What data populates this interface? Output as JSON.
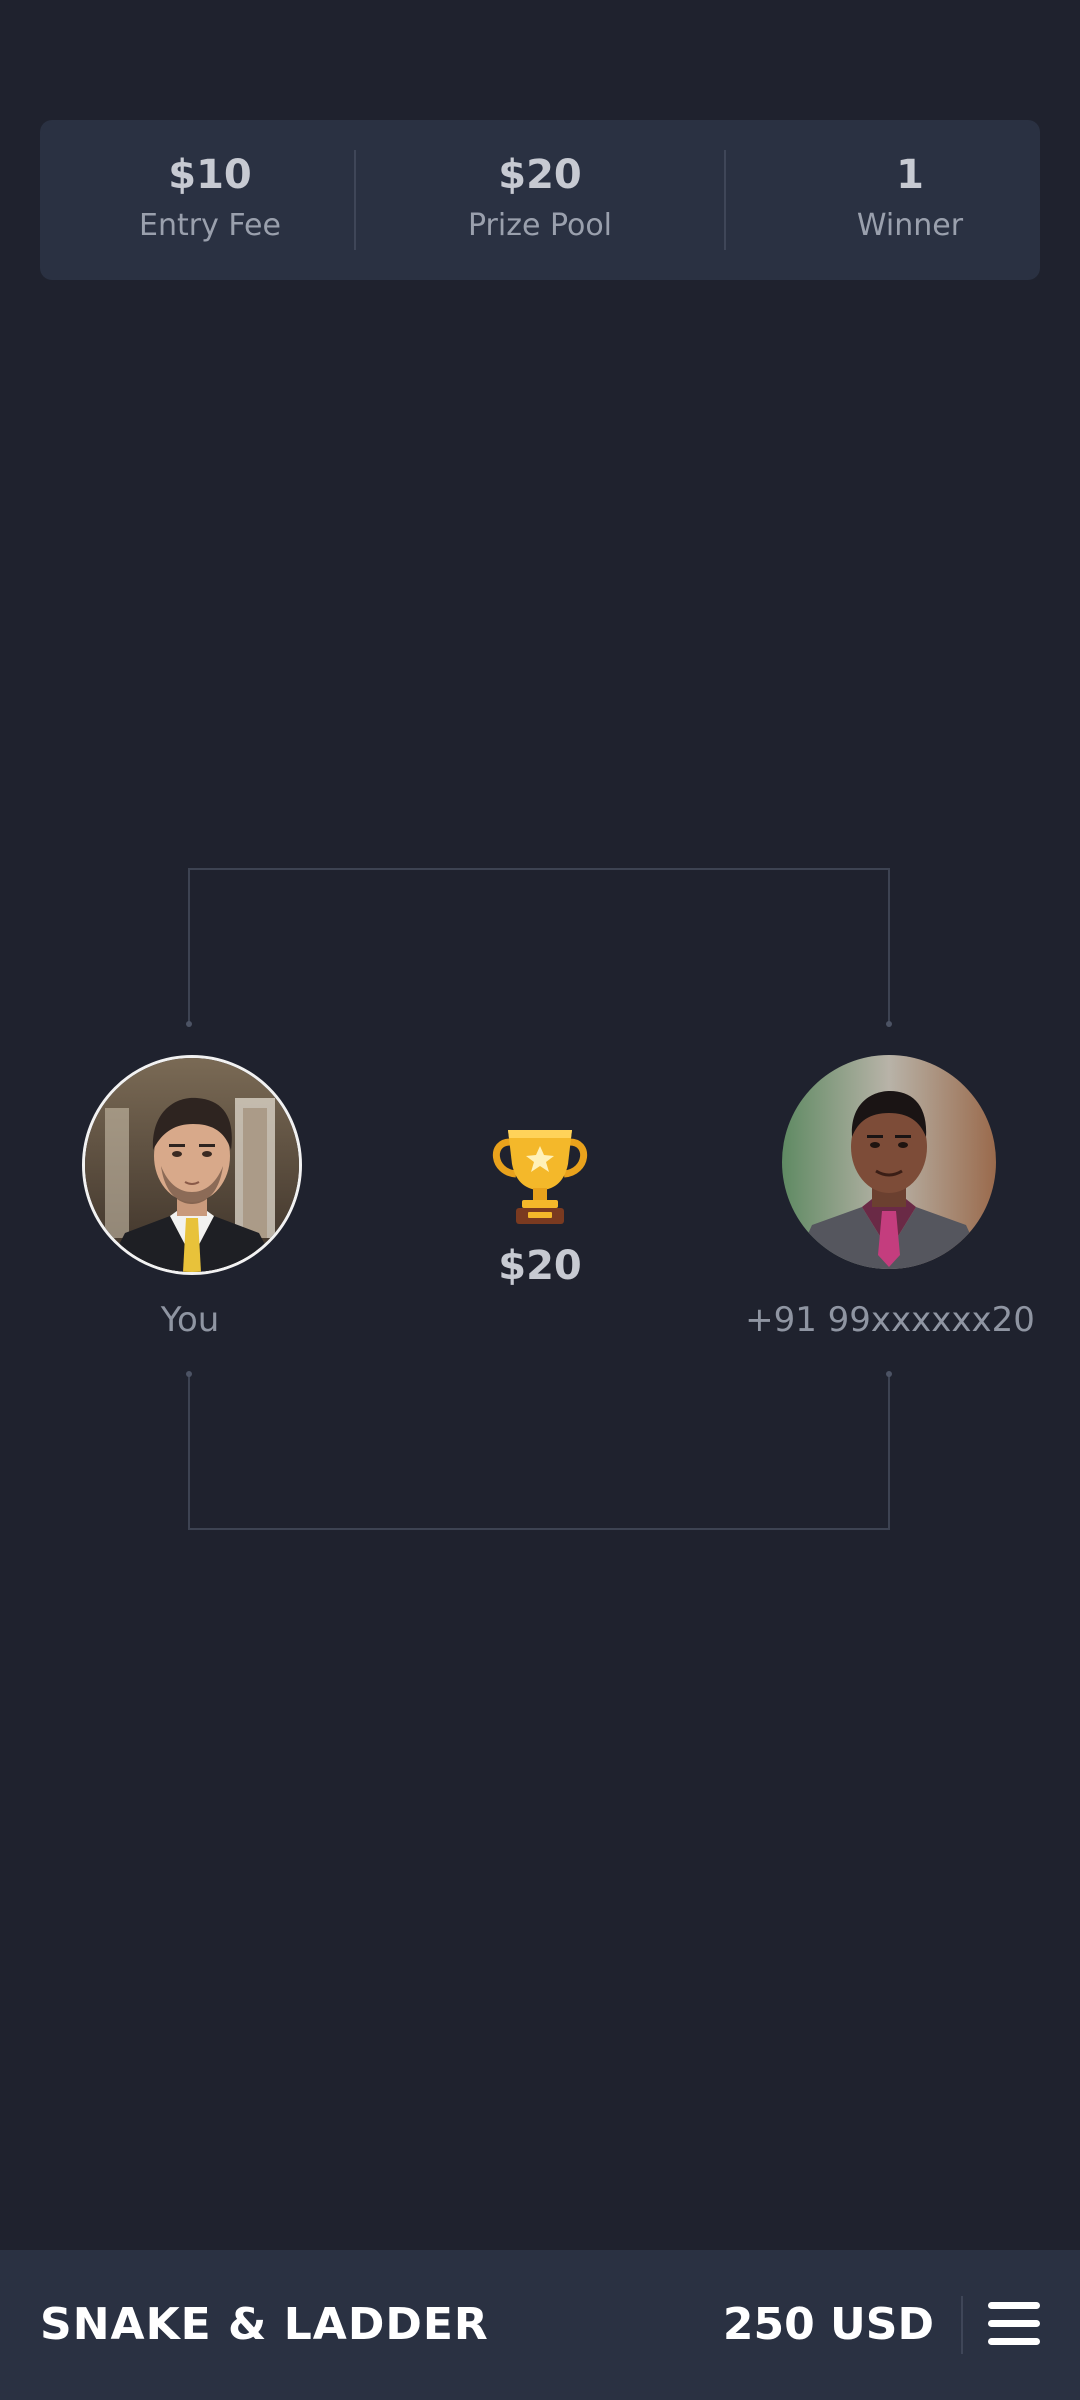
{
  "stats": {
    "entry_fee": {
      "value": "$10",
      "label": "Entry Fee"
    },
    "prize_pool": {
      "value": "$20",
      "label": "Prize Pool"
    },
    "winners": {
      "value": "1",
      "label": "Winner"
    }
  },
  "match": {
    "player_one": {
      "name": "You"
    },
    "player_two": {
      "name": "+91 99xxxxxx20"
    },
    "prize": "$20"
  },
  "footer": {
    "game_title": "SNAKE & LADDER",
    "balance": "250 USD"
  },
  "colors": {
    "background": "#1f222e",
    "card": "#2a3142",
    "trophy_gold": "#f4b82a",
    "text_primary": "#c7cad2",
    "text_secondary": "#9aa0ad"
  },
  "icons": {
    "trophy": "trophy-icon",
    "menu": "hamburger-menu-icon"
  }
}
